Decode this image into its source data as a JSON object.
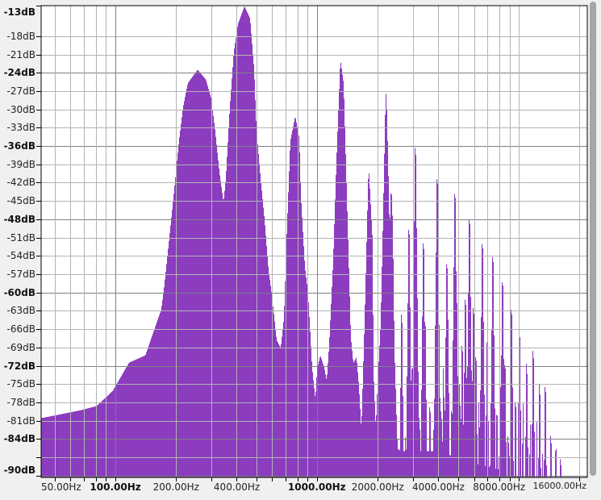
{
  "chart_data": {
    "type": "area",
    "title": "",
    "xlabel": "",
    "ylabel": "",
    "x_scale": "log",
    "xlim": [
      42.9,
      21880
    ],
    "ylim": [
      -90.3,
      -13
    ],
    "grid": true,
    "fill_color": "#8b3cbf",
    "y_ticks": [
      {
        "value": -13,
        "label": "-13dB",
        "major": true
      },
      {
        "value": -18,
        "label": "-18dB",
        "major": false
      },
      {
        "value": -21,
        "label": "-21dB",
        "major": false
      },
      {
        "value": -24,
        "label": "-24dB",
        "major": true
      },
      {
        "value": -27,
        "label": "-27dB",
        "major": false
      },
      {
        "value": -30,
        "label": "-30dB",
        "major": false
      },
      {
        "value": -33,
        "label": "-33dB",
        "major": false
      },
      {
        "value": -36,
        "label": "-36dB",
        "major": true
      },
      {
        "value": -39,
        "label": "-39dB",
        "major": false
      },
      {
        "value": -42,
        "label": "-42dB",
        "major": false
      },
      {
        "value": -45,
        "label": "-45dB",
        "major": false
      },
      {
        "value": -48,
        "label": "-48dB",
        "major": true
      },
      {
        "value": -51,
        "label": "-51dB",
        "major": false
      },
      {
        "value": -54,
        "label": "-54dB",
        "major": false
      },
      {
        "value": -57,
        "label": "-57dB",
        "major": false
      },
      {
        "value": -60,
        "label": "-60dB",
        "major": true
      },
      {
        "value": -63,
        "label": "-63dB",
        "major": false
      },
      {
        "value": -66,
        "label": "-66dB",
        "major": false
      },
      {
        "value": -69,
        "label": "-69dB",
        "major": false
      },
      {
        "value": -72,
        "label": "-72dB",
        "major": true
      },
      {
        "value": -75,
        "label": "-75dB",
        "major": false
      },
      {
        "value": -78,
        "label": "-78dB",
        "major": false
      },
      {
        "value": -81,
        "label": "-81dB",
        "major": false
      },
      {
        "value": -84,
        "label": "-84dB",
        "major": true
      },
      {
        "value": -87,
        "label": "",
        "major": false
      },
      {
        "value": -90,
        "label": "-90dB",
        "major": true
      }
    ],
    "x_grid": [
      50,
      60,
      70,
      80,
      90,
      100,
      200,
      300,
      400,
      500,
      600,
      700,
      800,
      900,
      1000,
      2000,
      3000,
      4000,
      5000,
      6000,
      7000,
      8000,
      9000,
      10000,
      20000
    ],
    "x_ticks": [
      {
        "value": 50,
        "label": "50.00Hz",
        "major": false
      },
      {
        "value": 100,
        "label": "100.00Hz",
        "major": true
      },
      {
        "value": 200,
        "label": "200.00Hz",
        "major": false
      },
      {
        "value": 400,
        "label": "400.00Hz",
        "major": false
      },
      {
        "value": 1000,
        "label": "1000.00Hz",
        "major": true
      },
      {
        "value": 2000,
        "label": "2000.00Hz",
        "major": false
      },
      {
        "value": 4000,
        "label": "4000.00Hz",
        "major": false
      },
      {
        "value": 8000,
        "label": "8000.00Hz",
        "major": false
      },
      {
        "value": 16000,
        "label": "16000.00Hz",
        "major": false,
        "small": true
      }
    ],
    "envelope": [
      [
        42.9,
        -80.6
      ],
      [
        67.3,
        -79.3
      ],
      [
        80.9,
        -78.6
      ],
      [
        97.3,
        -76.1
      ],
      [
        117,
        -71.5
      ],
      [
        141,
        -70.3
      ],
      [
        169,
        -62.8
      ],
      [
        174,
        -59.7
      ],
      [
        185,
        -51.3
      ],
      [
        194,
        -44.7
      ],
      [
        200,
        -40.2
      ],
      [
        207,
        -35.2
      ],
      [
        217,
        -29.6
      ],
      [
        229,
        -25.7
      ],
      [
        256,
        -23.5
      ],
      [
        281,
        -25.1
      ],
      [
        299,
        -28.2
      ],
      [
        313,
        -33.6
      ],
      [
        328,
        -40.2
      ],
      [
        344,
        -45.2
      ],
      [
        353,
        -41.6
      ],
      [
        370,
        -29.6
      ],
      [
        387,
        -20.6
      ],
      [
        406,
        -16
      ],
      [
        437,
        -13.1
      ],
      [
        466,
        -15.1
      ],
      [
        488,
        -23.5
      ],
      [
        501,
        -33.2
      ],
      [
        525,
        -41.2
      ],
      [
        550,
        -48.2
      ],
      [
        575,
        -56.3
      ],
      [
        597,
        -60.3
      ],
      [
        631,
        -67.8
      ],
      [
        661,
        -69.1
      ],
      [
        686,
        -64.2
      ],
      [
        705,
        -52.2
      ],
      [
        738,
        -35.2
      ],
      [
        780,
        -31.1
      ],
      [
        817,
        -34.6
      ],
      [
        832,
        -44.1
      ],
      [
        871,
        -55.8
      ],
      [
        904,
        -60.3
      ],
      [
        946,
        -72.3
      ],
      [
        982,
        -77.6
      ],
      [
        1000,
        -72.8
      ],
      [
        1038,
        -70.3
      ],
      [
        1087,
        -72.3
      ],
      [
        1117,
        -74.5
      ],
      [
        1148,
        -68.9
      ],
      [
        1202,
        -55.2
      ],
      [
        1247,
        -39.1
      ],
      [
        1306,
        -21.8
      ],
      [
        1355,
        -25.7
      ],
      [
        1380,
        -34.6
      ],
      [
        1472,
        -67.3
      ],
      [
        1514,
        -71.6
      ],
      [
        1570,
        -70.6
      ],
      [
        1614,
        -75.3
      ],
      [
        1660,
        -82.6
      ],
      [
        1722,
        -64.8
      ],
      [
        1803,
        -39.1
      ],
      [
        1888,
        -51.7
      ],
      [
        1905,
        -72.8
      ],
      [
        1959,
        -82.5
      ],
      [
        1977,
        -78.1
      ],
      [
        2070,
        -64.9
      ],
      [
        2128,
        -47.3
      ],
      [
        2188,
        -27.9
      ],
      [
        2208,
        -27.1
      ],
      [
        2249,
        -37.5
      ],
      [
        2291,
        -50
      ],
      [
        2333,
        -42
      ],
      [
        2377,
        -49
      ],
      [
        2421,
        -69.2
      ],
      [
        2489,
        -82
      ],
      [
        2512,
        -85.6
      ],
      [
        2606,
        -86
      ]
    ],
    "floor": [
      [
        2606,
        -86
      ],
      [
        4000,
        -86
      ],
      [
        6000,
        -88
      ],
      [
        8000,
        -89
      ],
      [
        9000,
        -95
      ]
    ],
    "spikes": [
      [
        2630,
        -58.3
      ],
      [
        2737,
        -81
      ],
      [
        2858,
        -44.1
      ],
      [
        2950,
        -71.5
      ],
      [
        3076,
        -30.9
      ],
      [
        3133,
        -54.3
      ],
      [
        3220,
        -75.5
      ],
      [
        3373,
        -46.4
      ],
      [
        3436,
        -59.2
      ],
      [
        3631,
        -73.2
      ],
      [
        3780,
        -80.5
      ],
      [
        3945,
        -35.8
      ],
      [
        3981,
        -46.8
      ],
      [
        4130,
        -74.1
      ],
      [
        4240,
        -68.8
      ],
      [
        4406,
        -49.7
      ],
      [
        4446,
        -57.9
      ],
      [
        4650,
        -75.5
      ],
      [
        4831,
        -38.2
      ],
      [
        4920,
        -55.2
      ],
      [
        5100,
        -70.8
      ],
      [
        5248,
        -63.2
      ],
      [
        5445,
        -55.6
      ],
      [
        5702,
        -42.4
      ],
      [
        5970,
        -57
      ],
      [
        6138,
        -64.9
      ],
      [
        6360,
        -74.1
      ],
      [
        6607,
        -46.4
      ],
      [
        6982,
        -62.6
      ],
      [
        7270,
        -78.1
      ],
      [
        7447,
        -48.6
      ],
      [
        7800,
        -74.1
      ],
      [
        8091,
        -69.2
      ],
      [
        8318,
        -52.6
      ],
      [
        8551,
        -66.2
      ],
      [
        8870,
        -78.1
      ],
      [
        9204,
        -57.2
      ],
      [
        9638,
        -72.4
      ],
      [
        10090,
        -60.7
      ],
      [
        10500,
        -75.5
      ],
      [
        10960,
        -66.5
      ],
      [
        11400,
        -78.1
      ],
      [
        11800,
        -64.2
      ],
      [
        12300,
        -80.7
      ],
      [
        12700,
        -69.9
      ],
      [
        13100,
        -84
      ],
      [
        13550,
        -69.9
      ],
      [
        14450,
        -78.1
      ],
      [
        15280,
        -79.8
      ],
      [
        16140,
        -81.8
      ],
      [
        17060,
        -86.4
      ]
    ]
  }
}
